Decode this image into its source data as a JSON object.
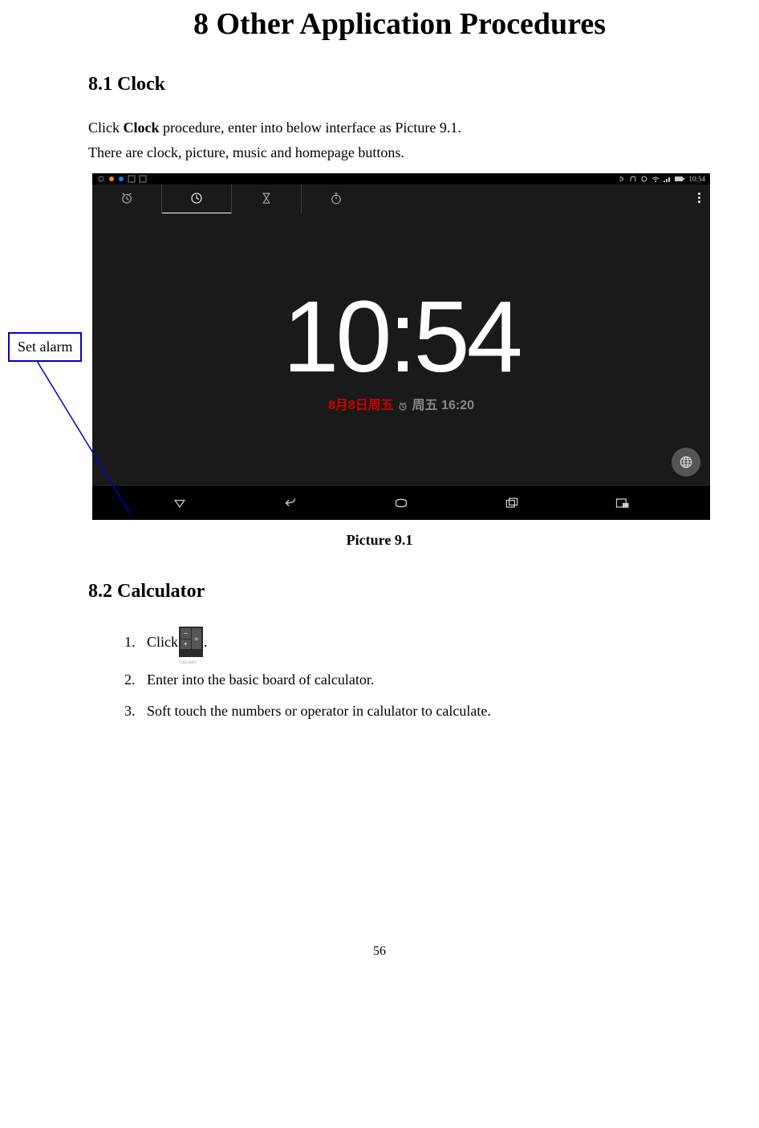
{
  "title": "8 Other Application Procedures",
  "sections": {
    "clock": {
      "heading": "8.1 Clock",
      "intro_prefix": "Click ",
      "intro_bold": "Clock",
      "intro_suffix": " procedure, enter into below interface as Picture 9.1.",
      "line2": "There are clock, picture, music and homepage buttons."
    },
    "calculator": {
      "heading": "8.2 Calculator",
      "items": {
        "step1_prefix": "Click",
        "step1_suffix": ".",
        "step2": "Enter into the basic board of calculator.",
        "step3": "Soft touch the numbers or operator in calulator to calculate."
      }
    }
  },
  "callout": "Set alarm",
  "caption": "Picture 9.1",
  "screenshot": {
    "status_time": "10:54",
    "big_time": "10:54",
    "date_red": "8月8日周五",
    "date_grey": "周五 16:20"
  },
  "calc_icon_label": "Calculator",
  "page_number": "56"
}
